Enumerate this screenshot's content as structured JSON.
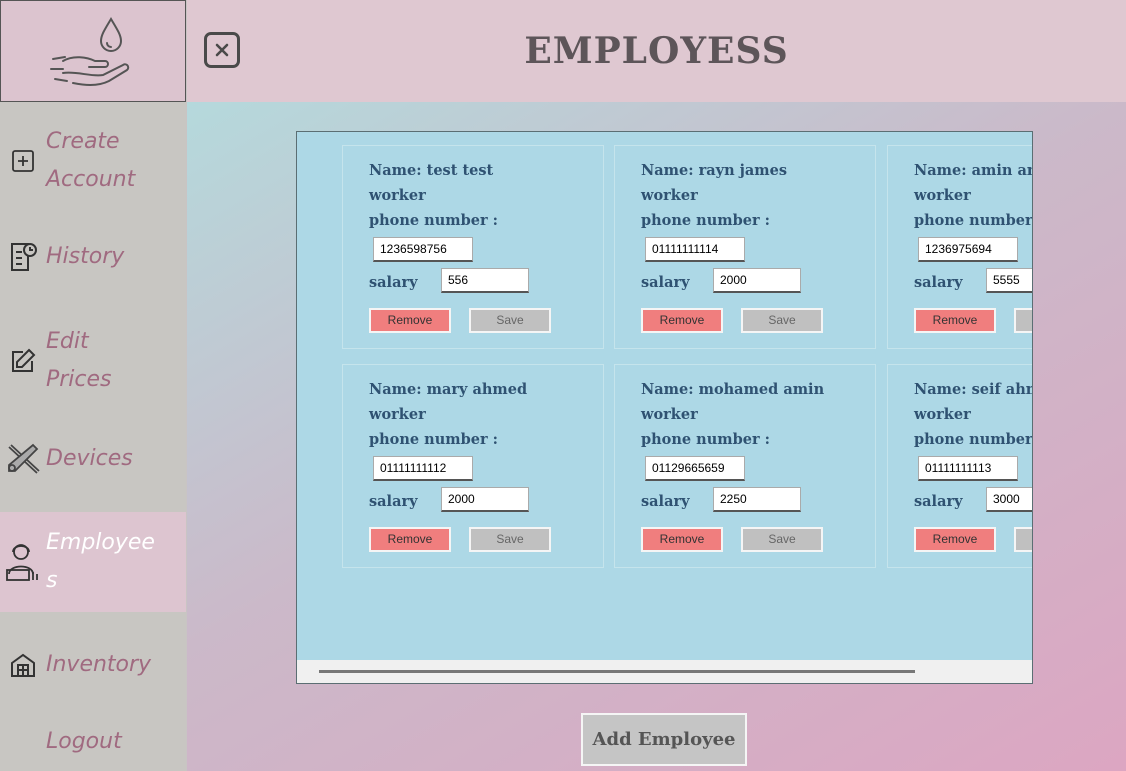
{
  "header": {
    "title": "EMPLOYESS"
  },
  "sidebar": {
    "items": [
      {
        "label": "Create Account",
        "icon": "plus-square-icon"
      },
      {
        "label": "History",
        "icon": "history-icon"
      },
      {
        "label": "Edit Prices",
        "icon": "edit-icon"
      },
      {
        "label": "Devices",
        "icon": "tools-icon"
      },
      {
        "label": "Employees",
        "icon": "employee-icon",
        "active": true
      },
      {
        "label": "Inventory",
        "icon": "warehouse-icon"
      },
      {
        "label": "Logout",
        "icon": ""
      }
    ]
  },
  "employees": [
    {
      "name": "Name: test test",
      "role": "worker",
      "phone_label": "phone number :",
      "phone": "1236598756",
      "salary_label": "salary",
      "salary": "556"
    },
    {
      "name": "Name: rayn james",
      "role": "worker",
      "phone_label": "phone number :",
      "phone": "01111111114",
      "salary_label": "salary",
      "salary": "2000"
    },
    {
      "name": "Name: amin amin",
      "role": "worker",
      "phone_label": "phone number :",
      "phone": "1236975694",
      "salary_label": "salary",
      "salary": "5555"
    },
    {
      "name": "Name: mary ahmed",
      "role": "worker",
      "phone_label": "phone number :",
      "phone": "01111111112",
      "salary_label": "salary",
      "salary": "2000"
    },
    {
      "name": "Name: mohamed amin",
      "role": "worker",
      "phone_label": "phone number :",
      "phone": "01129665659",
      "salary_label": "salary",
      "salary": "2250"
    },
    {
      "name": "Name: seif ahmed",
      "role": "worker",
      "phone_label": "phone number :",
      "phone": "01111111113",
      "salary_label": "salary",
      "salary": "3000"
    }
  ],
  "buttons": {
    "remove": "Remove",
    "save": "Save",
    "add_employee": "Add Employee"
  },
  "colors": {
    "remove": "#f07e7e",
    "panel": "#add8e6",
    "accent_text": "#2f5272",
    "nav_text": "#a06a80"
  }
}
